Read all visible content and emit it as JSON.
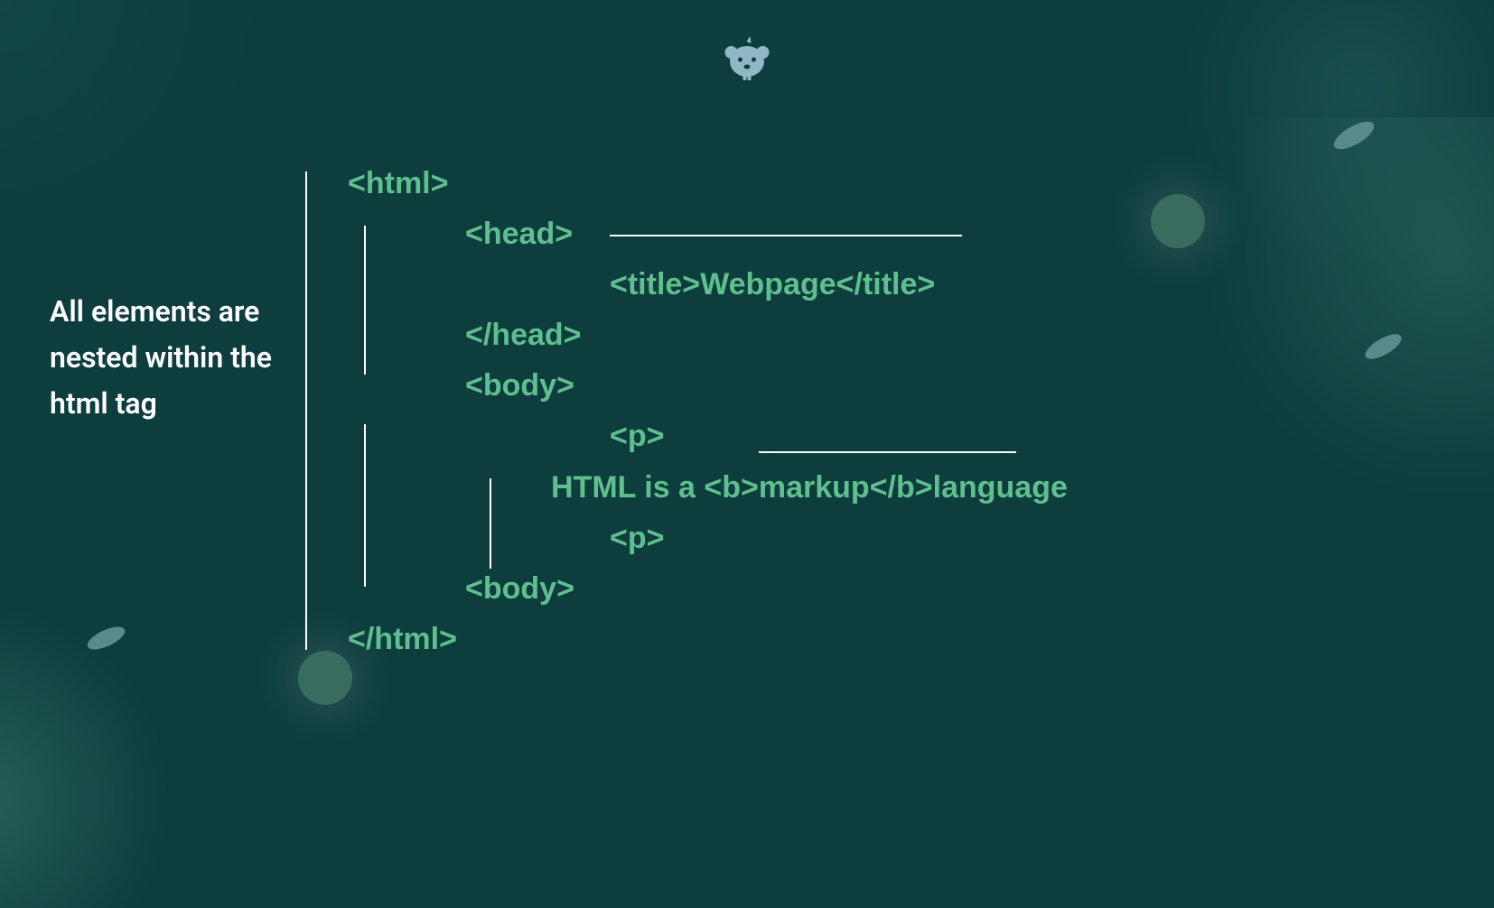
{
  "caption": "All elements are nested within the html tag",
  "code": {
    "html_open": "<html>",
    "head_open": "<head>",
    "title_line": "<title>Webpage</title>",
    "head_close": "</head>",
    "body_open": "<body>",
    "p_open": "<p>",
    "content_line": "HTML is a <b>markup</b>language",
    "p_close": "<p>",
    "body_close": "<body>",
    "html_close": "</html>"
  },
  "colors": {
    "background": "#0d3d3d",
    "code_text": "#5fbf8f",
    "caption_text": "#ffffff",
    "lines": "#ffffff"
  }
}
